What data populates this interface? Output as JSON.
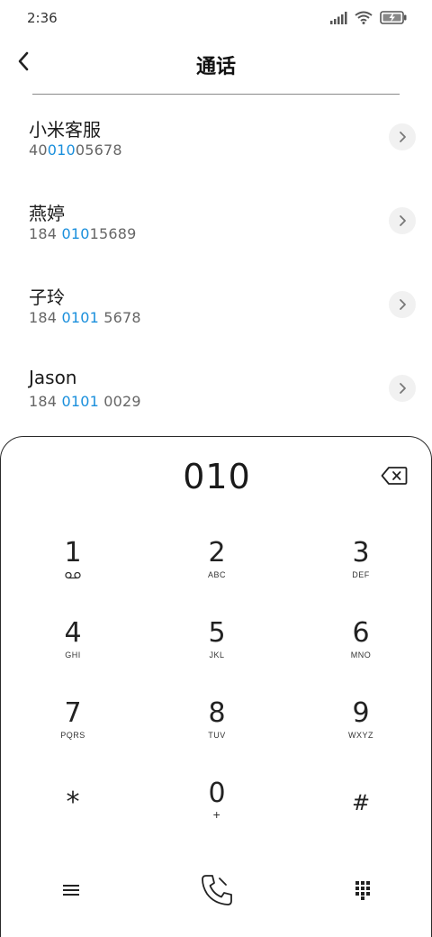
{
  "status_bar": {
    "time": "2:36",
    "icons": [
      "signal-icon",
      "wifi-icon",
      "battery-charging-icon"
    ]
  },
  "app_bar": {
    "title": "通话",
    "back_icon": "chevron-left-icon"
  },
  "contacts": [
    {
      "name": "小米客服",
      "number_pre": "40",
      "number_hl": "010",
      "number_post": "05678"
    },
    {
      "name": "燕婷",
      "number_pre": "184 ",
      "number_hl": "010",
      "number_post": "15689"
    },
    {
      "name": "子玲",
      "number_pre": "184 ",
      "number_hl": "0101",
      "number_post": " 5678"
    },
    {
      "name": "Jason",
      "number_pre": "184 ",
      "number_hl": "0101",
      "number_post": " 0029"
    }
  ],
  "dialpad": {
    "display": "010",
    "keys": [
      {
        "digit": "1",
        "letters": ""
      },
      {
        "digit": "2",
        "letters": "ABC"
      },
      {
        "digit": "3",
        "letters": "DEF"
      },
      {
        "digit": "4",
        "letters": "GHI"
      },
      {
        "digit": "5",
        "letters": "JKL"
      },
      {
        "digit": "6",
        "letters": "MNO"
      },
      {
        "digit": "7",
        "letters": "PQRS"
      },
      {
        "digit": "8",
        "letters": "TUV"
      },
      {
        "digit": "9",
        "letters": "WXYZ"
      },
      {
        "digit": "*",
        "letters": ""
      },
      {
        "digit": "0",
        "letters": "+"
      },
      {
        "digit": "#",
        "letters": ""
      }
    ]
  },
  "colors": {
    "highlight": "#1a8fdc",
    "text": "#1f1f1f",
    "secondary_text": "#666666",
    "chevron_bg": "#f1f1f1"
  }
}
